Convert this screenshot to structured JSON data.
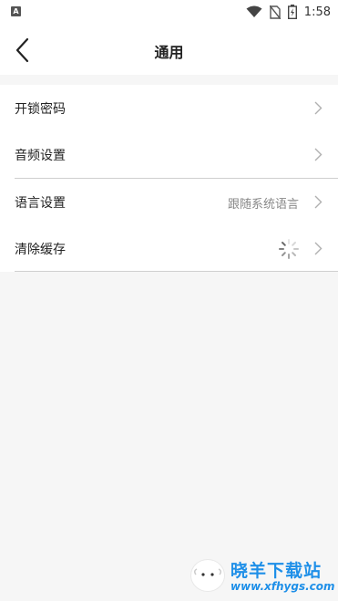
{
  "status_bar": {
    "time": "1:58"
  },
  "header": {
    "title": "通用"
  },
  "settings": {
    "group1": [
      {
        "label": "开锁密码"
      },
      {
        "label": "音频设置"
      }
    ],
    "group2": [
      {
        "label": "语言设置",
        "value": "跟随系统语言"
      },
      {
        "label": "清除缓存"
      }
    ]
  },
  "watermark": {
    "title": "晓羊下载站",
    "url": "www.xfhygs.com"
  },
  "colors": {
    "background": "#f6f6f6",
    "chevron": "#b0b0b0",
    "brand_watermark": "#1e8fe8"
  }
}
